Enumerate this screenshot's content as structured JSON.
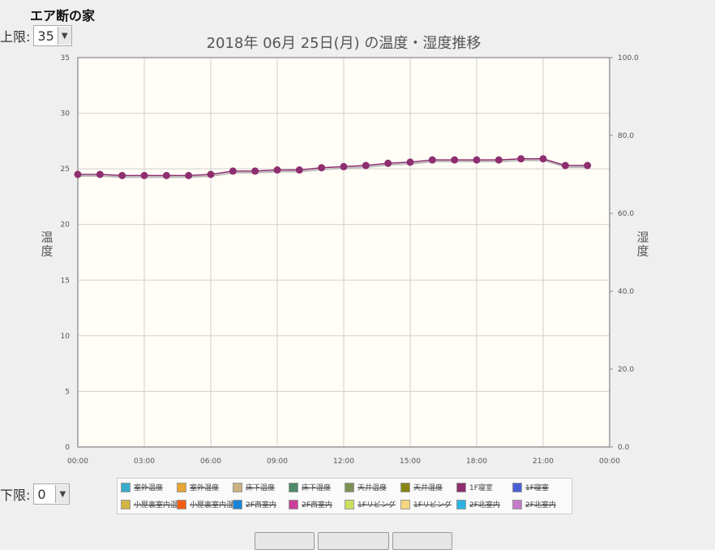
{
  "header": {
    "site_title": "エア断の家"
  },
  "limits": {
    "upper_label": "上限:",
    "upper_value": "35",
    "lower_label": "下限:",
    "lower_value": "0"
  },
  "chart_data": {
    "type": "line",
    "title": "2018年 06月 25日(月) の温度・湿度推移",
    "ylabel_left": "温度",
    "ylabel_right": "湿度",
    "ylim_left": [
      0,
      35
    ],
    "ylim_right": [
      0,
      100
    ],
    "yticks_left": [
      "0",
      "5",
      "10",
      "15",
      "20",
      "25",
      "30",
      "35"
    ],
    "yticks_right": [
      "0.0",
      "20.0",
      "40.0",
      "60.0",
      "80.0",
      "100.0"
    ],
    "xticks": [
      "00:00",
      "03:00",
      "06:00",
      "09:00",
      "12:00",
      "15:00",
      "18:00",
      "21:00",
      "00:00"
    ],
    "grid": true,
    "series": [
      {
        "name": "1F寝室",
        "color": "#8e2e6f",
        "x": [
          0,
          1,
          2,
          3,
          4,
          5,
          6,
          7,
          8,
          9,
          10,
          11,
          12,
          13,
          14,
          15,
          16,
          17,
          18,
          19,
          20,
          21,
          22,
          23
        ],
        "values": [
          24.5,
          24.5,
          24.4,
          24.4,
          24.4,
          24.4,
          24.5,
          24.8,
          24.8,
          24.9,
          24.9,
          25.1,
          25.2,
          25.3,
          25.5,
          25.6,
          25.8,
          25.8,
          25.8,
          25.8,
          25.9,
          25.9,
          25.3,
          25.3
        ]
      }
    ],
    "legend": [
      {
        "label": "室外温度",
        "color": "#3aaccb",
        "active": false
      },
      {
        "label": "室外湿度",
        "color": "#e8a531",
        "active": false
      },
      {
        "label": "床下温度",
        "color": "#c9b27f",
        "active": false
      },
      {
        "label": "床下湿度",
        "color": "#4d8b67",
        "active": false
      },
      {
        "label": "天井温度",
        "color": "#7c9254",
        "active": false
      },
      {
        "label": "天井湿度",
        "color": "#8a8415",
        "active": false
      },
      {
        "label": "1F寝室",
        "color": "#8e2e6f",
        "active": true
      },
      {
        "label": "1F寝室",
        "color": "#4a5fd6",
        "active": false
      },
      {
        "label": "小屋裏室内温度",
        "color": "#d4b444",
        "active": false
      },
      {
        "label": "小屋裏室内湿度",
        "color": "#f45d10",
        "active": false
      },
      {
        "label": "2F西室内",
        "color": "#1a84d6",
        "active": false
      },
      {
        "label": "2F西室内",
        "color": "#cc3e9c",
        "active": false
      },
      {
        "label": "1Fリビング",
        "color": "#cde05d",
        "active": false
      },
      {
        "label": "1Fリビング",
        "color": "#f6d67c",
        "active": false
      },
      {
        "label": "2F北室内",
        "color": "#2bb4e3",
        "active": false
      },
      {
        "label": "2F北室内",
        "color": "#c77ac9",
        "active": false
      }
    ]
  }
}
